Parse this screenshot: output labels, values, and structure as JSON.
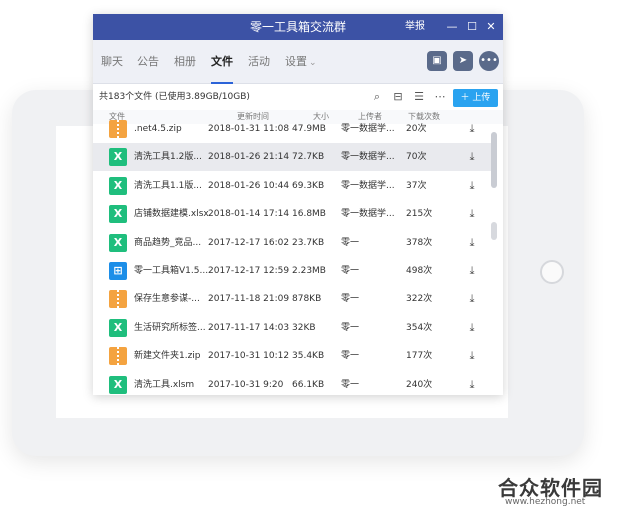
{
  "window": {
    "title": "零一工具箱交流群",
    "report_label": "举报",
    "minimize_glyph": "—",
    "maximize_glyph": "☐",
    "close_glyph": "✕"
  },
  "tabs": [
    {
      "label": "聊天"
    },
    {
      "label": "公告"
    },
    {
      "label": "相册"
    },
    {
      "label": "文件",
      "active": true
    },
    {
      "label": "活动"
    },
    {
      "label": "设置"
    }
  ],
  "toolbar_buttons": [
    "calendar-icon",
    "folder-share-icon",
    "more-icon"
  ],
  "files_info": {
    "summary": "共183个文件 (已使用3.89GB/10GB)",
    "upload_label": "上传"
  },
  "columns": {
    "name": "文件",
    "time": "更新时间",
    "size": "大小",
    "uploader": "上传者",
    "downloads": "下载次数"
  },
  "files": [
    {
      "icon": "zip",
      "name": ".net4.5.zip",
      "time": "2018-01-31 11:08",
      "size": "47.9MB",
      "uploader": "零一数据学...",
      "downloads": "20次"
    },
    {
      "icon": "xls",
      "name": "清洗工具1.2版...",
      "time": "2018-01-26 21:14",
      "size": "72.7KB",
      "uploader": "零一数据学...",
      "downloads": "70次"
    },
    {
      "icon": "xls",
      "name": "清洗工具1.1版...",
      "time": "2018-01-26 10:44",
      "size": "69.3KB",
      "uploader": "零一数据学...",
      "downloads": "37次"
    },
    {
      "icon": "xls",
      "name": "店铺数据建模.xlsx",
      "time": "2018-01-14 17:14",
      "size": "16.8MB",
      "uploader": "零一数据学...",
      "downloads": "215次"
    },
    {
      "icon": "xls",
      "name": "商品趋势_竞品...",
      "time": "2017-12-17 16:02",
      "size": "23.7KB",
      "uploader": "零一",
      "downloads": "378次"
    },
    {
      "icon": "exe",
      "name": "零一工具箱V1.5...",
      "time": "2017-12-17 12:59",
      "size": "2.23MB",
      "uploader": "零一",
      "downloads": "498次"
    },
    {
      "icon": "zip",
      "name": "保存生意参谋-...",
      "time": "2017-11-18 21:09",
      "size": "878KB",
      "uploader": "零一",
      "downloads": "322次"
    },
    {
      "icon": "xls",
      "name": "生活研究所标签...",
      "time": "2017-11-17 14:03",
      "size": "32KB",
      "uploader": "零一",
      "downloads": "354次"
    },
    {
      "icon": "zip",
      "name": "新建文件夹1.zip",
      "time": "2017-10-31 10:12",
      "size": "35.4KB",
      "uploader": "零一",
      "downloads": "177次"
    },
    {
      "icon": "xls",
      "name": "清洗工具.xlsm",
      "time": "2017-10-31 9:20",
      "size": "66.1KB",
      "uploader": "零一",
      "downloads": "240次"
    }
  ],
  "watermark": {
    "brand": "合众软件园",
    "url": "www.hezhong.net"
  },
  "colors": {
    "titlebar": "#3c52a5",
    "accent": "#2aa3f0",
    "zip_icon": "#f4a340",
    "xls_icon": "#1fbe7d",
    "exe_icon": "#1c8ee8"
  }
}
